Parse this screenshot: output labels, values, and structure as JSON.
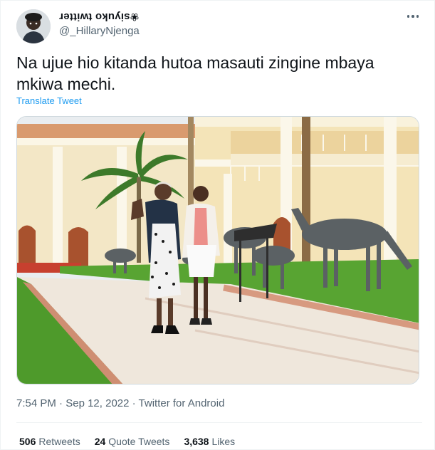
{
  "author": {
    "display_name": "❀siyuko twitter",
    "handle": "@_HillaryNjenga",
    "avatar_icon": "avatar-photo"
  },
  "menu": {
    "icon": "more-dots-icon"
  },
  "tweet": {
    "text": "Na ujue hio kitanda hutoa masauti zingine mbaya mkiwa mechi.",
    "translate_label": "Translate Tweet"
  },
  "media": {
    "kind": "photo",
    "description_icon": "photo-two-women-walking-courtyard"
  },
  "timestamp": {
    "time": "7:54 PM",
    "separator1": " · ",
    "date": "Sep 12, 2022",
    "separator2": " · ",
    "source": "Twitter for Android"
  },
  "stats": {
    "retweets_count": "506",
    "retweets_label": "Retweets",
    "quotes_count": "24",
    "quotes_label": "Quote Tweets",
    "likes_count": "3,638",
    "likes_label": "Likes"
  },
  "colors": {
    "text": "#0f1419",
    "secondary": "#536471",
    "link": "#1d9bf0",
    "border": "#eff3f4"
  }
}
